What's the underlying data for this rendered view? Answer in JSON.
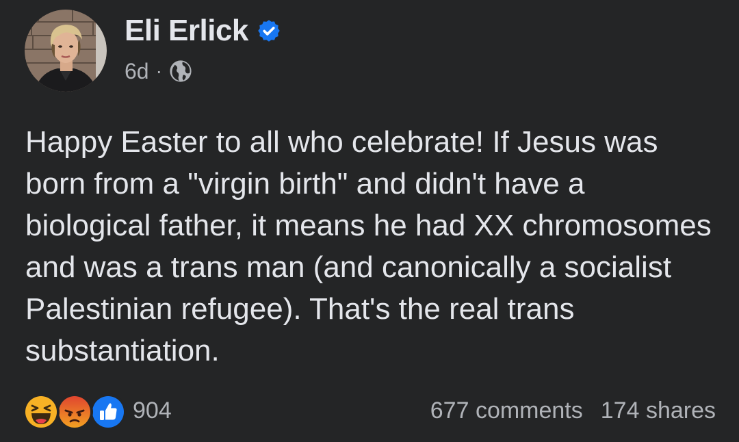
{
  "author": {
    "name": "Eli Erlick",
    "verified": true
  },
  "meta": {
    "time": "6d",
    "separator": "·",
    "audience_icon": "globe-icon"
  },
  "post": {
    "text": "Happy Easter to all who celebrate! If Jesus was born from a \"virgin birth\" and didn't have a biological father, it means he had XX chromosomes and was a trans man (and canonically a socialist Palestinian refugee). That's the real trans substantiation."
  },
  "footer": {
    "reaction_icons": [
      "haha-reaction-icon",
      "angry-reaction-icon",
      "like-reaction-icon"
    ],
    "reaction_count": "904",
    "comments": "677 comments",
    "shares": "174 shares"
  },
  "colors": {
    "background": "#242526",
    "primary_text": "#e4e6eb",
    "secondary_text": "#b0b3b8",
    "verified_blue": "#1877f2",
    "haha_yellow": "#f7b125",
    "angry_orange": "#e9710f",
    "like_blue": "#1877f2"
  }
}
